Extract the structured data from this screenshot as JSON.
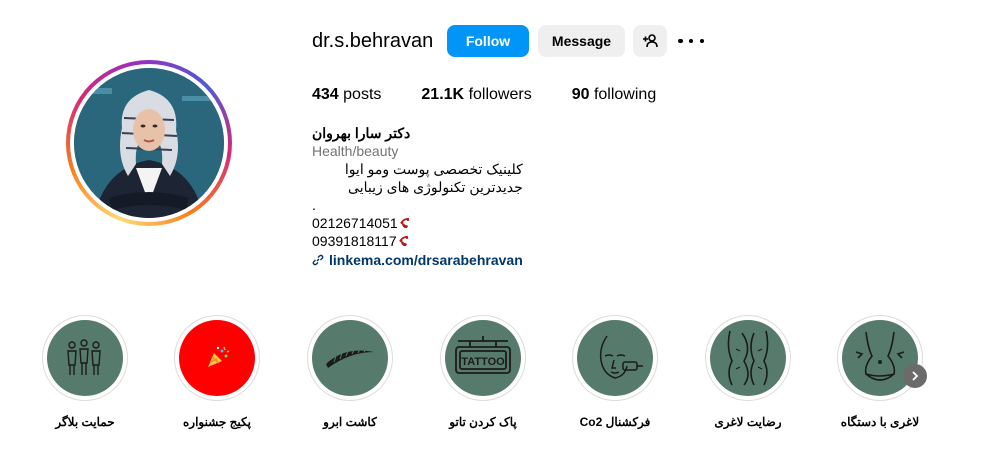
{
  "profile": {
    "username": "dr.s.behravan",
    "follow_label": "Follow",
    "message_label": "Message"
  },
  "stats": {
    "posts_count": "434",
    "posts_label": "posts",
    "followers_count": "21.1K",
    "followers_label": "followers",
    "following_count": "90",
    "following_label": "following"
  },
  "bio": {
    "name": "دکتر سارا بهروان",
    "category": "Health/beauty",
    "line1": "کلینیک تخصصی پوست ومو ایوا",
    "line2": "جدیدترین تکنولوژی های زیبایی",
    "line3": ".",
    "phone1": "02126714051",
    "phone2": "09391818117",
    "link": "linkema.com/drsarabehravan"
  },
  "highlights": [
    {
      "label": "حمایت بلاگر",
      "icon": "people-icon",
      "color": "#567b6c"
    },
    {
      "label": "پکیج جشنواره",
      "icon": "party-popper-icon",
      "color": "#ff0000"
    },
    {
      "label": "کاشت ابرو",
      "icon": "eyebrow-icon",
      "color": "#567b6c"
    },
    {
      "label": "پاک کردن تاتو",
      "icon": "tattoo-sign-icon",
      "color": "#567b6c"
    },
    {
      "label": "فرکشنال Co2",
      "icon": "face-laser-icon",
      "color": "#567b6c"
    },
    {
      "label": "رضایت لاغری",
      "icon": "body-silhouette-icon",
      "color": "#567b6c"
    },
    {
      "label": "لاغری با دستگاه",
      "icon": "torso-slimming-icon",
      "color": "#567b6c"
    }
  ]
}
